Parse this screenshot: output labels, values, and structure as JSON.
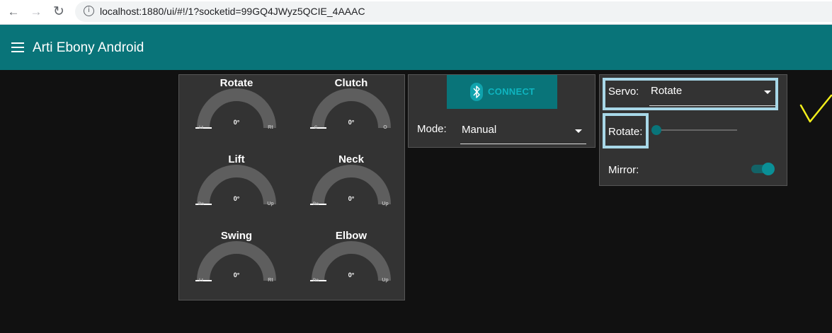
{
  "browser": {
    "url": "localhost:1880/ui/#!/1?socketid=99GQ4JWyz5QCIE_4AAAC",
    "back_icon": "back-arrow-icon",
    "forward_icon": "forward-arrow-icon",
    "reload_icon": "reload-icon",
    "info_icon": "info-icon"
  },
  "app": {
    "title": "Arti Ebony Android",
    "menu_icon": "hamburger-menu-icon",
    "accent_color": "#097479"
  },
  "gauges": [
    {
      "title": "Rotate",
      "value": "0°",
      "min": "Lt",
      "max": "Rt"
    },
    {
      "title": "Clutch",
      "value": "0°",
      "min": "C",
      "max": "O"
    },
    {
      "title": "Lift",
      "value": "0°",
      "min": "Dn",
      "max": "Up"
    },
    {
      "title": "Neck",
      "value": "0°",
      "min": "Dn",
      "max": "Up"
    },
    {
      "title": "Swing",
      "value": "0°",
      "min": "Lt",
      "max": "Rt"
    },
    {
      "title": "Elbow",
      "value": "0°",
      "min": "Dn",
      "max": "Up"
    }
  ],
  "control": {
    "connect_label": "CONNECT",
    "connect_icon": "bluetooth-icon",
    "mode_label": "Mode:",
    "mode_value": "Manual"
  },
  "servo_panel": {
    "servo_label": "Servo:",
    "servo_value": "Rotate",
    "slider_label": "Rotate:",
    "slider_value": 0,
    "mirror_label": "Mirror:",
    "mirror_on": true
  }
}
